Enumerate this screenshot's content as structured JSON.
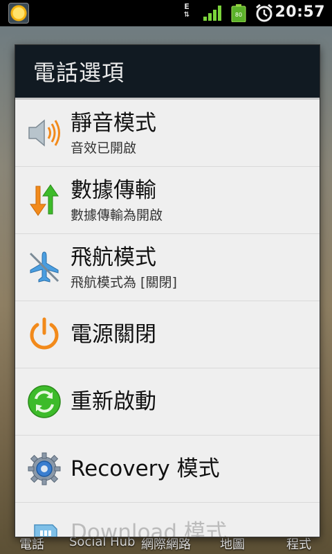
{
  "status_bar": {
    "clock": "20:57",
    "network_type": "E",
    "battery_level": "80",
    "icons": [
      "weather-notification-icon",
      "signal-icon",
      "battery-icon",
      "alarm-icon"
    ]
  },
  "dock": {
    "items": [
      "電話",
      "Social Hub",
      "網際網路",
      "地圖",
      "程式"
    ]
  },
  "dialog": {
    "title": "電話選項",
    "items": [
      {
        "label": "靜音模式",
        "sub": "音效已開啟",
        "icon": "speaker-volume-icon"
      },
      {
        "label": "數據傳輸",
        "sub": "數據傳輸為開啟",
        "icon": "data-transfer-arrows-icon"
      },
      {
        "label": "飛航模式",
        "sub": "飛航模式為 [關閉]",
        "icon": "airplane-off-icon"
      },
      {
        "label": "電源關閉",
        "sub": "",
        "icon": "power-icon"
      },
      {
        "label": "重新啟動",
        "sub": "",
        "icon": "restart-icon"
      },
      {
        "label": "Recovery 模式",
        "sub": "",
        "icon": "recovery-gear-icon"
      },
      {
        "label": "Download 模式",
        "sub": "",
        "icon": "download-sim-icon"
      }
    ]
  },
  "colors": {
    "dialog_title_bg": "#111a22",
    "dialog_bg": "#efefef",
    "accent_orange": "#f28a1b",
    "accent_green": "#3dbb2a"
  }
}
